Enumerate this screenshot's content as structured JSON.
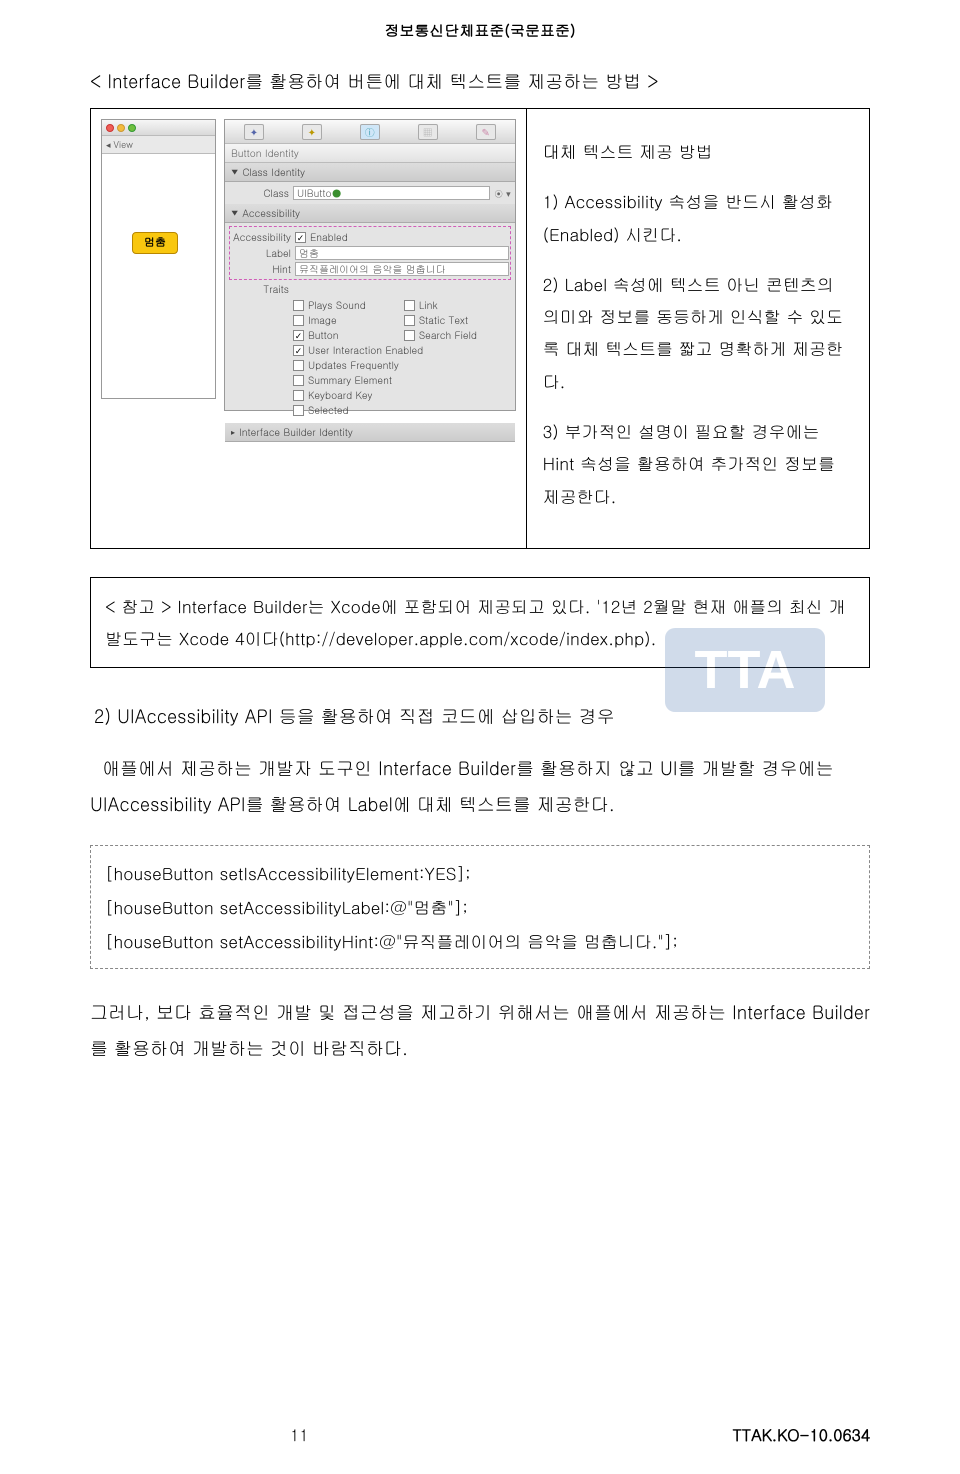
{
  "header": "정보통신단체표준(국문표준)",
  "title": "< Interface Builder를 활용하여 버튼에 대체 텍스트를 제공하는 방법 >",
  "sim": {
    "view_label": "View",
    "button_label": "멈춤",
    "traffic": {
      "red": "#ef5f57",
      "yellow": "#f3bb3e",
      "green": "#6fbf3e"
    }
  },
  "inspector": {
    "tab_title": "Button Identity",
    "sections": {
      "class_identity": "Class Identity",
      "class_label": "Class",
      "class_value": "UIButto",
      "accessibility": "Accessibility",
      "acc_label": "Accessibility",
      "acc_enabled": "Enabled",
      "label_label": "Label",
      "label_value": "멈춤",
      "hint_label": "Hint",
      "hint_value": "뮤직플레이어의 음악을 멈춥니다",
      "traits_label": "Traits",
      "traits": {
        "plays_sound": "Plays Sound",
        "link": "Link",
        "image": "Image",
        "static_text": "Static Text",
        "button": "Button",
        "search_field": "Search Field",
        "user_interaction": "User Interaction Enabled",
        "updates": "Updates Frequently",
        "summary": "Summary Element",
        "keyboard": "Keyboard Key",
        "selected": "Selected"
      },
      "ib_identity": "Interface Builder Identity"
    }
  },
  "right": {
    "heading": "대체 텍스트 제공 방법",
    "p1": "1) Accessibility 속성을 반드시 활성화(Enabled) 시킨다.",
    "p2": "2) Label 속성에 텍스트 아닌 콘텐츠의 의미와 정보를 동등하게 인식할 수 있도록 대체 텍스트를 짧고 명확하게 제공한다.",
    "p3": "3) 부가적인 설명이 필요할 경우에는 Hint 속성을 활용하여 추가적인 정보를 제공한다."
  },
  "note": "< 참고 > Interface Builder는 Xcode에 포함되어 제공되고 있다. '12년 2월말 현재 애플의 최신 개발도구는 Xcode 4이다(http://developer.apple.com/xcode/index.php).",
  "section2": {
    "title": "2) UIAccessibility API 등을 활용하여 직접 코드에 삽입하는 경우",
    "para": "애플에서 제공하는 개발자 도구인 Interface Builder를 활용하지 않고 UI를 개발할 경우에는 UIAccessibility API를 활용하여 Label에 대체 텍스트를 제공한다."
  },
  "code": {
    "l1": "[houseButton setIsAccessibilityElement:YES];",
    "l2": "[houseButton setAccessibilityLabel:@\"멈춤\"];",
    "l3": "[houseButton setAccessibilityHint:@\"뮤직플레이어의 음악을 멈춥니다.\"];"
  },
  "closing": "그러나, 보다 효율적인 개발 및 접근성을 제고하기 위해서는 애플에서 제공하는 Interface Builder를 활용하여 개발하는 것이 바람직하다.",
  "footer": {
    "page": "11",
    "code": "TTAK.KO-10.0634"
  },
  "watermark": "TTA"
}
